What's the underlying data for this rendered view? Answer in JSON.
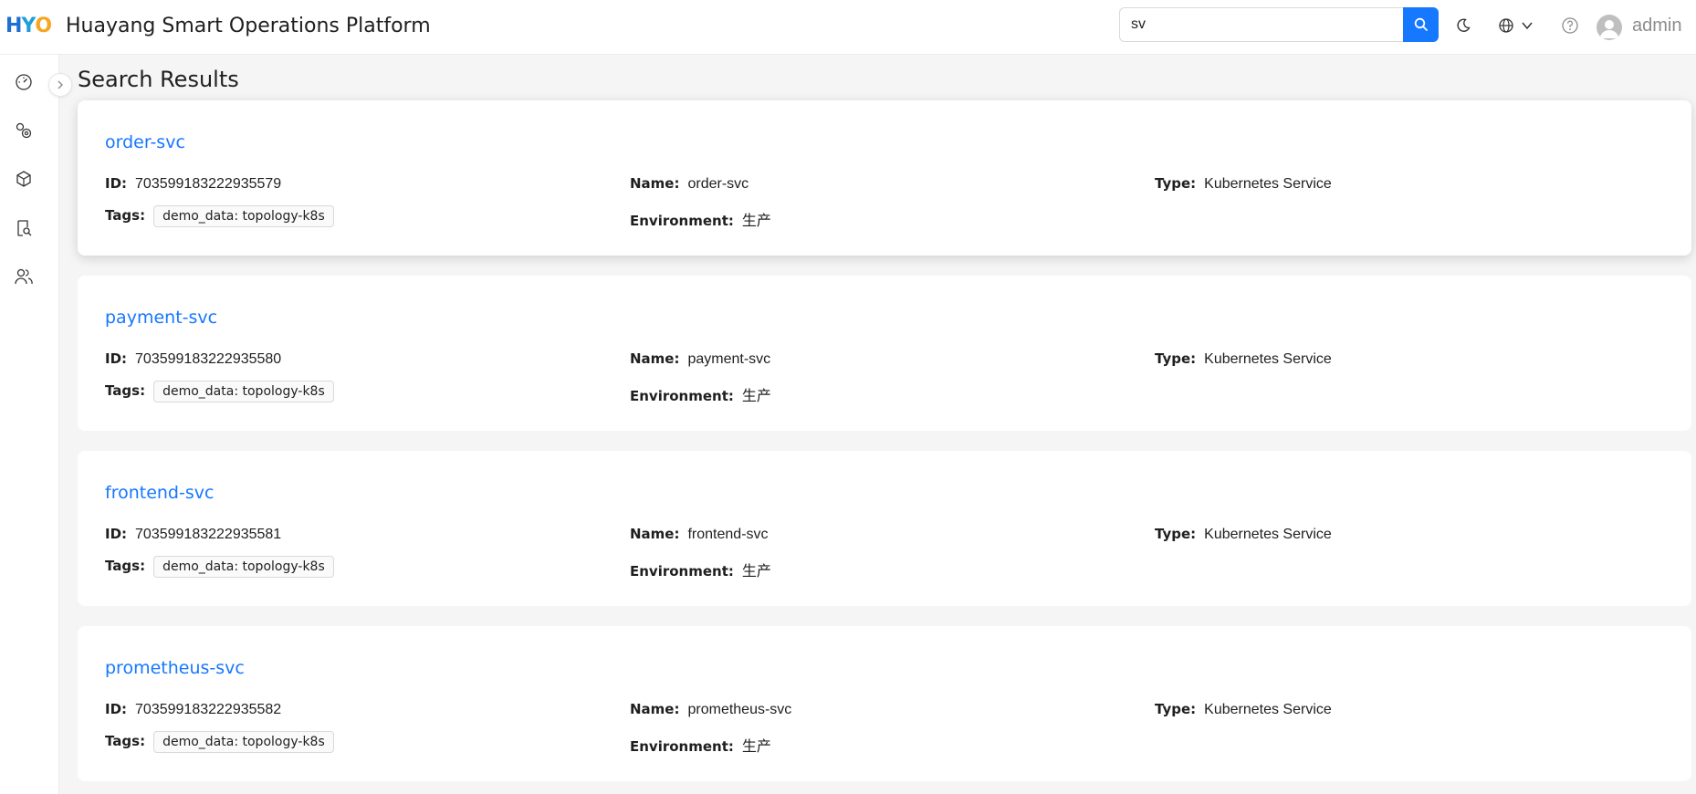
{
  "header": {
    "logo": {
      "part1": "H",
      "part2": "Y",
      "part3": "O"
    },
    "title": "Huayang Smart Operations Platform",
    "search_value": "sv",
    "user": "admin"
  },
  "colors": {
    "accent": "#1677ff",
    "logo_blue": "#1f6fd1",
    "logo_orange": "#f5a623"
  },
  "sidebar": {
    "icons": [
      "dashboard-icon",
      "settings-gears-icon",
      "cube-icon",
      "document-search-icon",
      "users-icon"
    ]
  },
  "page_title": "Search Results",
  "labels": {
    "id": "ID:",
    "name": "Name:",
    "type": "Type:",
    "tags": "Tags:",
    "environment": "Environment:"
  },
  "results": [
    {
      "title": "order-svc",
      "id": "703599183222935579",
      "name": "order-svc",
      "type": "Kubernetes Service",
      "tag": "demo_data: topology-k8s",
      "environment": "生产"
    },
    {
      "title": "payment-svc",
      "id": "703599183222935580",
      "name": "payment-svc",
      "type": "Kubernetes Service",
      "tag": "demo_data: topology-k8s",
      "environment": "生产"
    },
    {
      "title": "frontend-svc",
      "id": "703599183222935581",
      "name": "frontend-svc",
      "type": "Kubernetes Service",
      "tag": "demo_data: topology-k8s",
      "environment": "生产"
    },
    {
      "title": "prometheus-svc",
      "id": "703599183222935582",
      "name": "prometheus-svc",
      "type": "Kubernetes Service",
      "tag": "demo_data: topology-k8s",
      "environment": "生产"
    }
  ]
}
